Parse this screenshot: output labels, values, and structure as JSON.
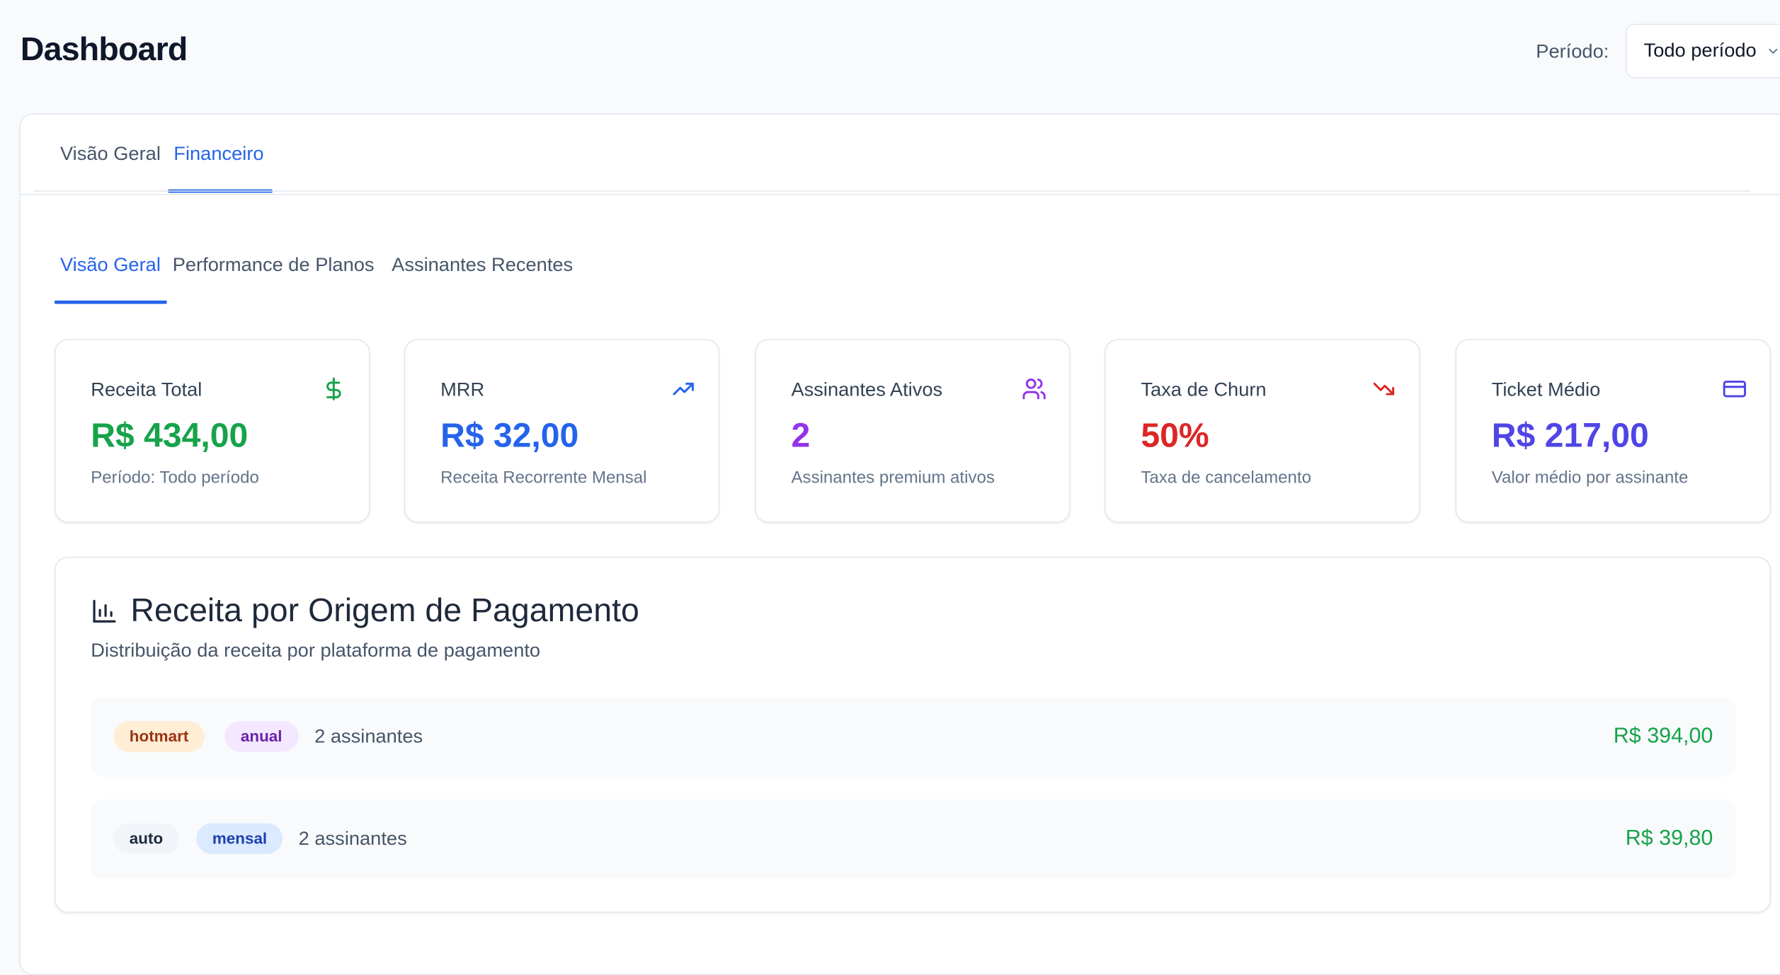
{
  "header": {
    "title": "Dashboard",
    "period_label": "Período:",
    "period_value": "Todo período"
  },
  "tabs_top": [
    {
      "label": "Visão Geral",
      "active": false
    },
    {
      "label": "Financeiro",
      "active": true
    }
  ],
  "tabs_sub": [
    {
      "label": "Visão Geral",
      "active": true
    },
    {
      "label": "Performance de Planos",
      "active": false
    },
    {
      "label": "Assinantes Recentes",
      "active": false
    }
  ],
  "kpis": [
    {
      "title": "Receita Total",
      "value": "R$ 434,00",
      "subtitle": "Período: Todo período",
      "icon": "dollar-icon",
      "color": "#16a34a"
    },
    {
      "title": "MRR",
      "value": "R$ 32,00",
      "subtitle": "Receita Recorrente Mensal",
      "icon": "trending-up-icon",
      "color": "#2563eb"
    },
    {
      "title": "Assinantes Ativos",
      "value": "2",
      "subtitle": "Assinantes premium ativos",
      "icon": "users-icon",
      "color": "#9333ea"
    },
    {
      "title": "Taxa de Churn",
      "value": "50%",
      "subtitle": "Taxa de cancelamento",
      "icon": "trending-down-icon",
      "color": "#dc2626"
    },
    {
      "title": "Ticket Médio",
      "value": "R$ 217,00",
      "subtitle": "Valor médio por assinante",
      "icon": "credit-card-icon",
      "color": "#4f46e5"
    }
  ],
  "revenue": {
    "title": "Receita por Origem de Pagamento",
    "subtitle": "Distribuição da receita por plataforma de pagamento",
    "rows": [
      {
        "source": "hotmart",
        "plan": "anual",
        "count": "2 assinantes",
        "amount": "R$ 394,00"
      },
      {
        "source": "auto",
        "plan": "mensal",
        "count": "2 assinantes",
        "amount": "R$ 39,80"
      }
    ]
  },
  "colors": {
    "accent": "#2563eb",
    "positive": "#16a34a",
    "negative": "#dc2626"
  }
}
